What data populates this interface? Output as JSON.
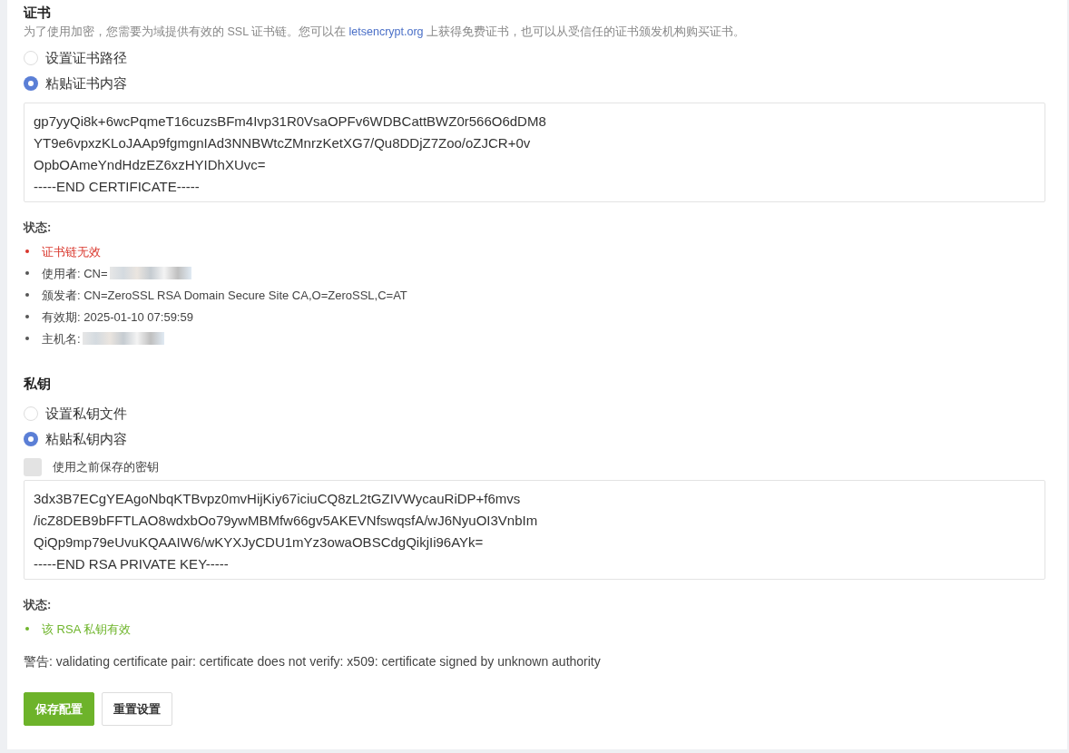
{
  "certificate": {
    "title": "证书",
    "description_parts": [
      "为了使用加密，您需要为域提供有效的 SSL 证书链。您可以在 ",
      "letsencrypt.org",
      " 上获得免费证书，也可以从受信任的证书颁发机构购买证书。"
    ],
    "options": [
      {
        "label": "设置证书路径",
        "selected": false
      },
      {
        "label": "粘贴证书内容",
        "selected": true
      }
    ],
    "content_lines": [
      "gp7yyQi8k+6wcPqmeT16cuzsBFm4Ivp31R0VsaOPFv6WDBCattBWZ0r566O6dDM8",
      "YT9e6vpxzKLoJAAp9fgmgnIAd3NNBWtcZMnrzKetXG7/Qu8DDjZ7Zoo/oZJCR+0v",
      "OpbOAmeYndHdzEZ6xzHYIDhXUvc=",
      "-----END CERTIFICATE-----"
    ],
    "status_label": "状态:",
    "status_items": [
      {
        "kind": "error",
        "text": "证书链无效",
        "redacted": false
      },
      {
        "kind": "normal",
        "text": "使用者: CN=",
        "redacted": true
      },
      {
        "kind": "normal",
        "text": "颁发者: CN=ZeroSSL RSA Domain Secure Site CA,O=ZeroSSL,C=AT",
        "redacted": false
      },
      {
        "kind": "normal",
        "text": "有效期: 2025-01-10 07:59:59",
        "redacted": false
      },
      {
        "kind": "normal",
        "text": "主机名:",
        "redacted": true
      }
    ]
  },
  "private_key": {
    "title": "私钥",
    "options": [
      {
        "label": "设置私钥文件",
        "selected": false
      },
      {
        "label": "粘贴私钥内容",
        "selected": true
      }
    ],
    "use_saved": {
      "label": "使用之前保存的密钥",
      "checked": false
    },
    "content_lines": [
      "3dx3B7ECgYEAgoNbqKTBvpz0mvHijKiy67iciuCQ8zL2tGZIVWycauRiDP+f6mvs",
      "/icZ8DEB9bFFTLAO8wdxbOo79ywMBMfw66gv5AKEVNfswqsfA/wJ6NyuOI3VnbIm",
      "QiQp9mp79eUvuKQAAIW6/wKYXJyCDU1mYz3owaOBSCdgQikjIi96AYk=",
      "-----END RSA PRIVATE KEY-----"
    ],
    "status_label": "状态:",
    "status_items": [
      {
        "kind": "success",
        "text": "该 RSA 私钥有效",
        "redacted": false
      }
    ]
  },
  "warning": "警告: validating certificate pair: certificate does not verify: x509: certificate signed by unknown authority",
  "buttons": [
    {
      "kind": "primary",
      "label": "保存配置"
    },
    {
      "kind": "default",
      "label": "重置设置"
    }
  ]
}
